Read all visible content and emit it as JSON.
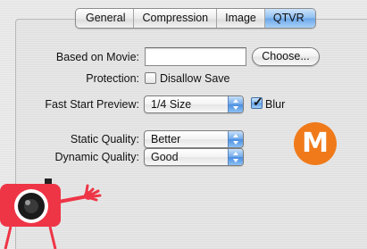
{
  "tabs": [
    {
      "label": "General"
    },
    {
      "label": "Compression"
    },
    {
      "label": "Image"
    },
    {
      "label": "QTVR"
    }
  ],
  "active_tab": "QTVR",
  "form": {
    "based_on_movie": {
      "label": "Based on Movie:",
      "value": "",
      "button": "Choose..."
    },
    "protection": {
      "label": "Protection:",
      "checkbox_label": "Disallow Save",
      "checked": false
    },
    "fast_start_preview": {
      "label": "Fast Start Preview:",
      "value": "1/4 Size",
      "blur_label": "Blur",
      "blur_checked": true
    },
    "static_quality": {
      "label": "Static Quality:",
      "value": "Better"
    },
    "dynamic_quality": {
      "label": "Dynamic Quality:",
      "value": "Good"
    }
  },
  "badge": {
    "letter": "M",
    "color": "#f07a1a"
  },
  "icons": {
    "popup_arrows": "up-down-arrows-icon",
    "mascot": "camera-mascot-icon"
  }
}
